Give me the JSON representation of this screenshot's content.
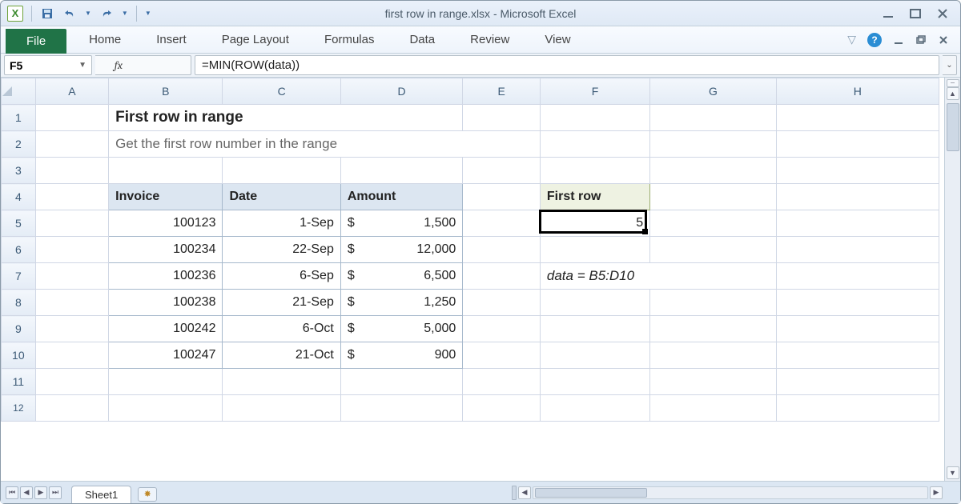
{
  "title": "first row in range.xlsx  -  Microsoft Excel",
  "qat": {
    "logo_letter": "X"
  },
  "ribbon": {
    "file": "File",
    "tabs": [
      "Home",
      "Insert",
      "Page Layout",
      "Formulas",
      "Data",
      "Review",
      "View"
    ]
  },
  "namebox": "F5",
  "fx_label": "fx",
  "formula": "=MIN(ROW(data))",
  "columns": [
    "A",
    "B",
    "C",
    "D",
    "E",
    "F",
    "G",
    "H"
  ],
  "rows_visible": [
    1,
    2,
    3,
    4,
    5,
    6,
    7,
    8,
    9,
    10,
    11,
    12
  ],
  "selected_cell": "F5",
  "sheet": {
    "title": "First row in range",
    "subtitle": "Get the first row number in the range",
    "table": {
      "headers": [
        "Invoice",
        "Date",
        "Amount"
      ],
      "rows": [
        {
          "invoice": "100123",
          "date": "1-Sep",
          "currency": "$",
          "amount": "1,500"
        },
        {
          "invoice": "100234",
          "date": "22-Sep",
          "currency": "$",
          "amount": "12,000"
        },
        {
          "invoice": "100236",
          "date": "6-Sep",
          "currency": "$",
          "amount": "6,500"
        },
        {
          "invoice": "100238",
          "date": "21-Sep",
          "currency": "$",
          "amount": "1,250"
        },
        {
          "invoice": "100242",
          "date": "6-Oct",
          "currency": "$",
          "amount": "5,000"
        },
        {
          "invoice": "100247",
          "date": "21-Oct",
          "currency": "$",
          "amount": "900"
        }
      ]
    },
    "result_label": "First row",
    "result_value": "5",
    "note": "data = B5:D10"
  },
  "tabs": {
    "sheet_name": "Sheet1"
  }
}
